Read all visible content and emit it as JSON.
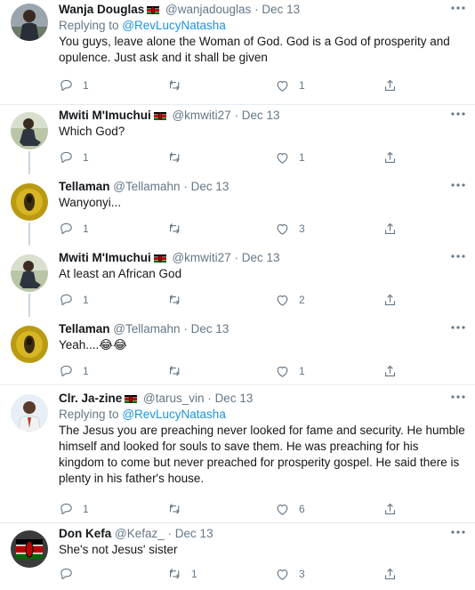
{
  "tweets": [
    {
      "name": "Wanja Douglas",
      "handle": "@wanjadouglas",
      "date": "Dec 13",
      "replying_label": "Replying to",
      "replying_to": "@RevLucyNatasha",
      "text": "You guys, leave alone the Woman of God. God is a God of prosperity and opulence. Just ask and it shall be given",
      "replies": "1",
      "retweets": "",
      "likes": "1"
    },
    {
      "name": "Mwiti M'Imuchui",
      "handle": "@kmwiti27",
      "date": "Dec 13",
      "text": "Which God?",
      "replies": "1",
      "retweets": "",
      "likes": "1"
    },
    {
      "name": "Tellaman",
      "handle": "@Tellamahn",
      "date": "Dec 13",
      "text": "Wanyonyi...",
      "replies": "1",
      "retweets": "",
      "likes": "3"
    },
    {
      "name": "Mwiti M'Imuchui",
      "handle": "@kmwiti27",
      "date": "Dec 13",
      "text": "At least an African God",
      "replies": "1",
      "retweets": "",
      "likes": "2"
    },
    {
      "name": "Tellaman",
      "handle": "@Tellamahn",
      "date": "Dec 13",
      "text": "Yeah....😂😂",
      "replies": "1",
      "retweets": "",
      "likes": "1"
    },
    {
      "name": "Clr. Ja-zine",
      "handle": "@tarus_vin",
      "date": "Dec 13",
      "replying_label": "Replying to",
      "replying_to": "@RevLucyNatasha",
      "text_lines": [
        "The Jesus you are preaching never looked for fame and security. He humble",
        "himself and looked for souls to save them. He was preaching for his",
        "kingdom to come but never preached for prosperity gospel. He said there is",
        "plenty in his father's house."
      ],
      "replies": "1",
      "retweets": "",
      "likes": "6"
    },
    {
      "name": "Don Kefa",
      "handle": "@Kefaz_",
      "date": "Dec 13",
      "text": "She's not Jesus' sister",
      "replies": "",
      "retweets": "1",
      "likes": "3"
    }
  ],
  "separator": "·",
  "colors": {
    "text": "#14171a",
    "muted": "#657786",
    "link": "#1b95e0",
    "border": "#e6ecf0"
  },
  "icons": [
    "reply-icon",
    "retweet-icon",
    "like-icon",
    "share-icon",
    "more-icon",
    "kenya-flag-icon"
  ]
}
